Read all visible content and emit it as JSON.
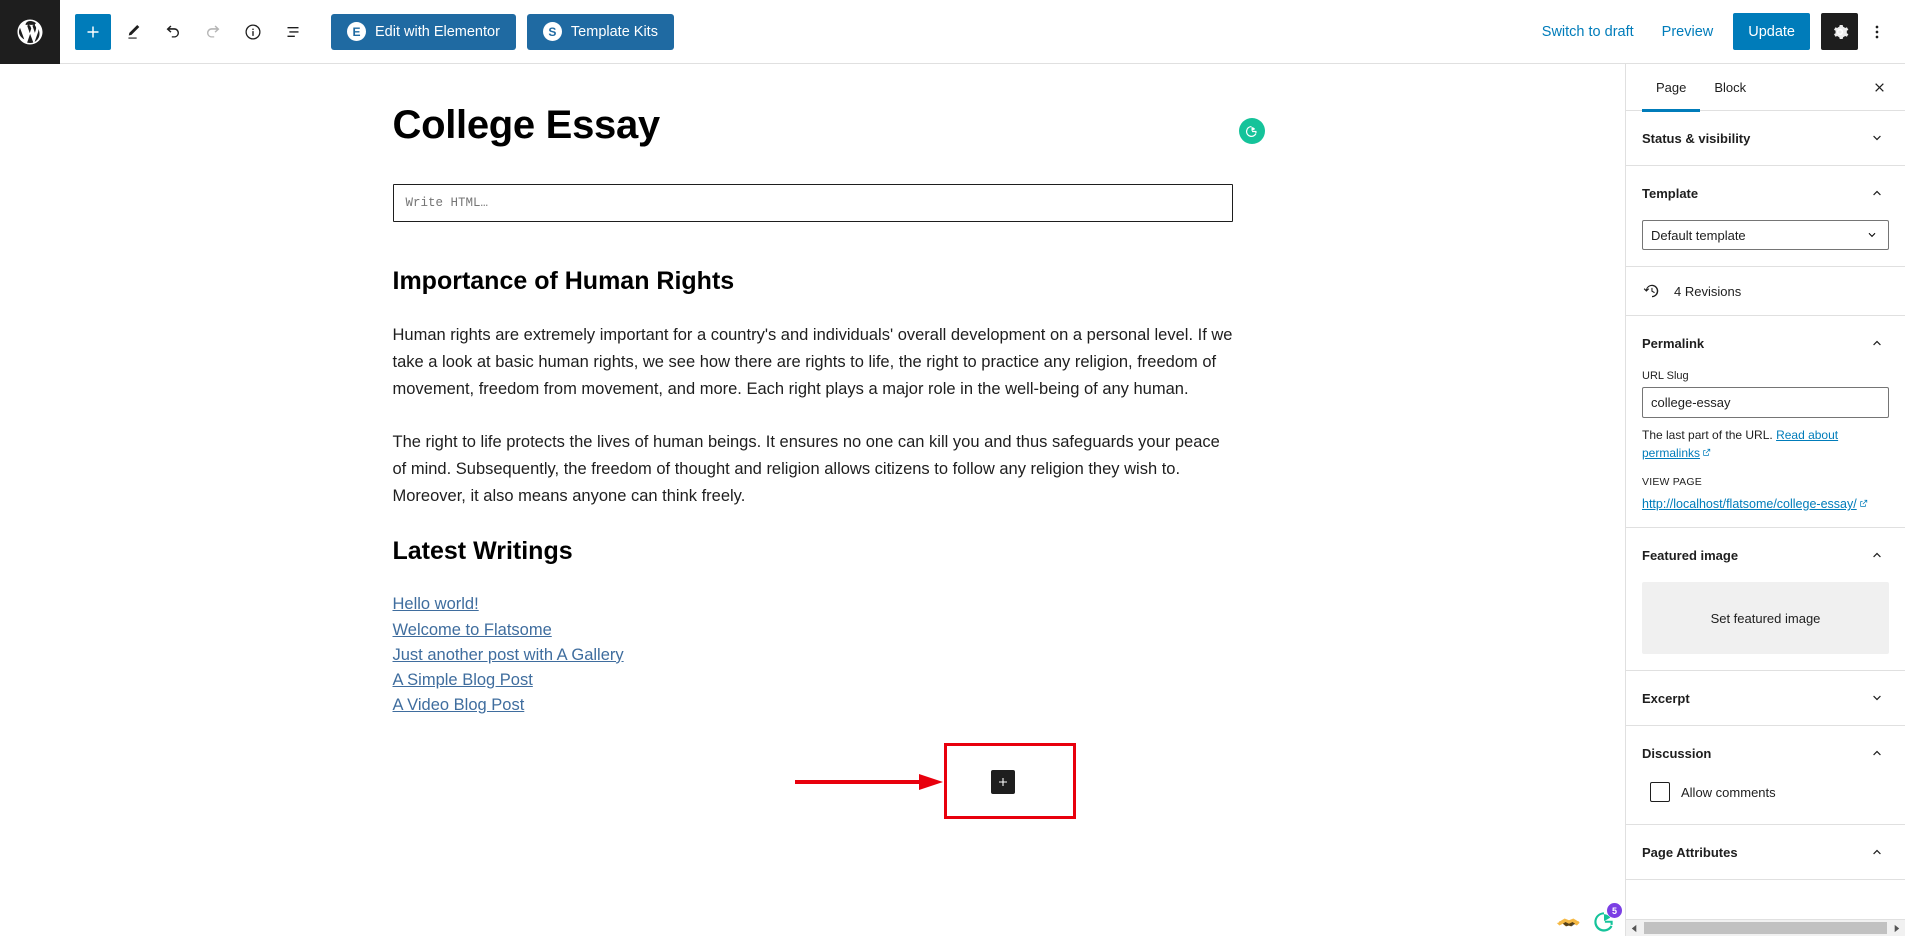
{
  "topbar": {
    "wp_logo_name": "wordpress-logo",
    "add_block_label": "+",
    "tools": [
      {
        "name": "add-block-button",
        "icon": "plus-icon"
      },
      {
        "name": "edit-tool-button",
        "icon": "pencil-icon"
      },
      {
        "name": "undo-button",
        "icon": "undo-icon"
      },
      {
        "name": "redo-button",
        "icon": "redo-icon"
      },
      {
        "name": "details-button",
        "icon": "info-icon"
      },
      {
        "name": "list-view-button",
        "icon": "list-view-icon"
      }
    ],
    "elementor_button": "Edit with Elementor",
    "elementor_badge": "E",
    "template_kits_button": "Template Kits",
    "template_kits_badge": "S",
    "switch_to_draft": "Switch to draft",
    "preview": "Preview",
    "update": "Update",
    "settings_icon": "gear-icon",
    "options_icon": "kebab-menu-icon",
    "accent_color": "#007cba",
    "button_blue": "#1f6aa2"
  },
  "sidebar": {
    "tabs": [
      {
        "label": "Page",
        "active": true
      },
      {
        "label": "Block",
        "active": false
      }
    ],
    "close_icon": "close-icon",
    "status_visibility": {
      "title": "Status & visibility",
      "expanded": false
    },
    "template": {
      "title": "Template",
      "expanded": true,
      "selected": "Default template"
    },
    "revisions": {
      "label": "4 Revisions",
      "icon": "revisions-clock-icon"
    },
    "permalink": {
      "title": "Permalink",
      "expanded": true,
      "slug_label": "URL Slug",
      "slug_value": "college-essay",
      "helper_prefix": "The last part of the URL. ",
      "helper_link": "Read about permalinks",
      "view_page_label": "VIEW PAGE",
      "view_page_url": "http://localhost/flatsome/college-essay/"
    },
    "featured_image": {
      "title": "Featured image",
      "expanded": true,
      "set_label": "Set featured image"
    },
    "excerpt": {
      "title": "Excerpt",
      "expanded": false
    },
    "discussion": {
      "title": "Discussion",
      "expanded": true,
      "allow_comments_label": "Allow comments",
      "allow_comments_checked": false
    },
    "page_attributes": {
      "title": "Page Attributes",
      "expanded": true
    }
  },
  "editor": {
    "post_title": "College Essay",
    "grammarly_icon": "grammarly-icon",
    "html_block_placeholder": "Write HTML…",
    "heading_1": "Importance of Human Rights",
    "paragraph_1": "Human rights are extremely important for a country's and individuals' overall development on a personal level. If we take a look at basic human rights, we see how there are rights to life, the right to practice any religion, freedom of movement, freedom from movement, and more. Each right plays a major role in the well-being of any human.",
    "paragraph_2": "The right to life protects the lives of human beings. It ensures no one can kill you and thus safeguards your peace of mind. Subsequently, the freedom of thought and religion allows citizens to follow any religion they wish to. Moreover, it also means anyone can think freely.",
    "heading_2": "Latest Writings",
    "links": [
      "Hello world!",
      "Welcome to Flatsome",
      "Just another post with A Gallery",
      "A Simple Blog Post",
      "A Video Blog Post"
    ]
  },
  "annotation": {
    "color": "#e8000d",
    "box_name": "highlight-box",
    "arrow_name": "pointer-arrow",
    "add_block_inserter_icon": "plus-icon"
  },
  "floating": {
    "handshake_icon": "handshake-icon",
    "grammarly_icon": "grammarly-icon",
    "badge_count": "5",
    "badge_color": "#7b3fe4"
  }
}
